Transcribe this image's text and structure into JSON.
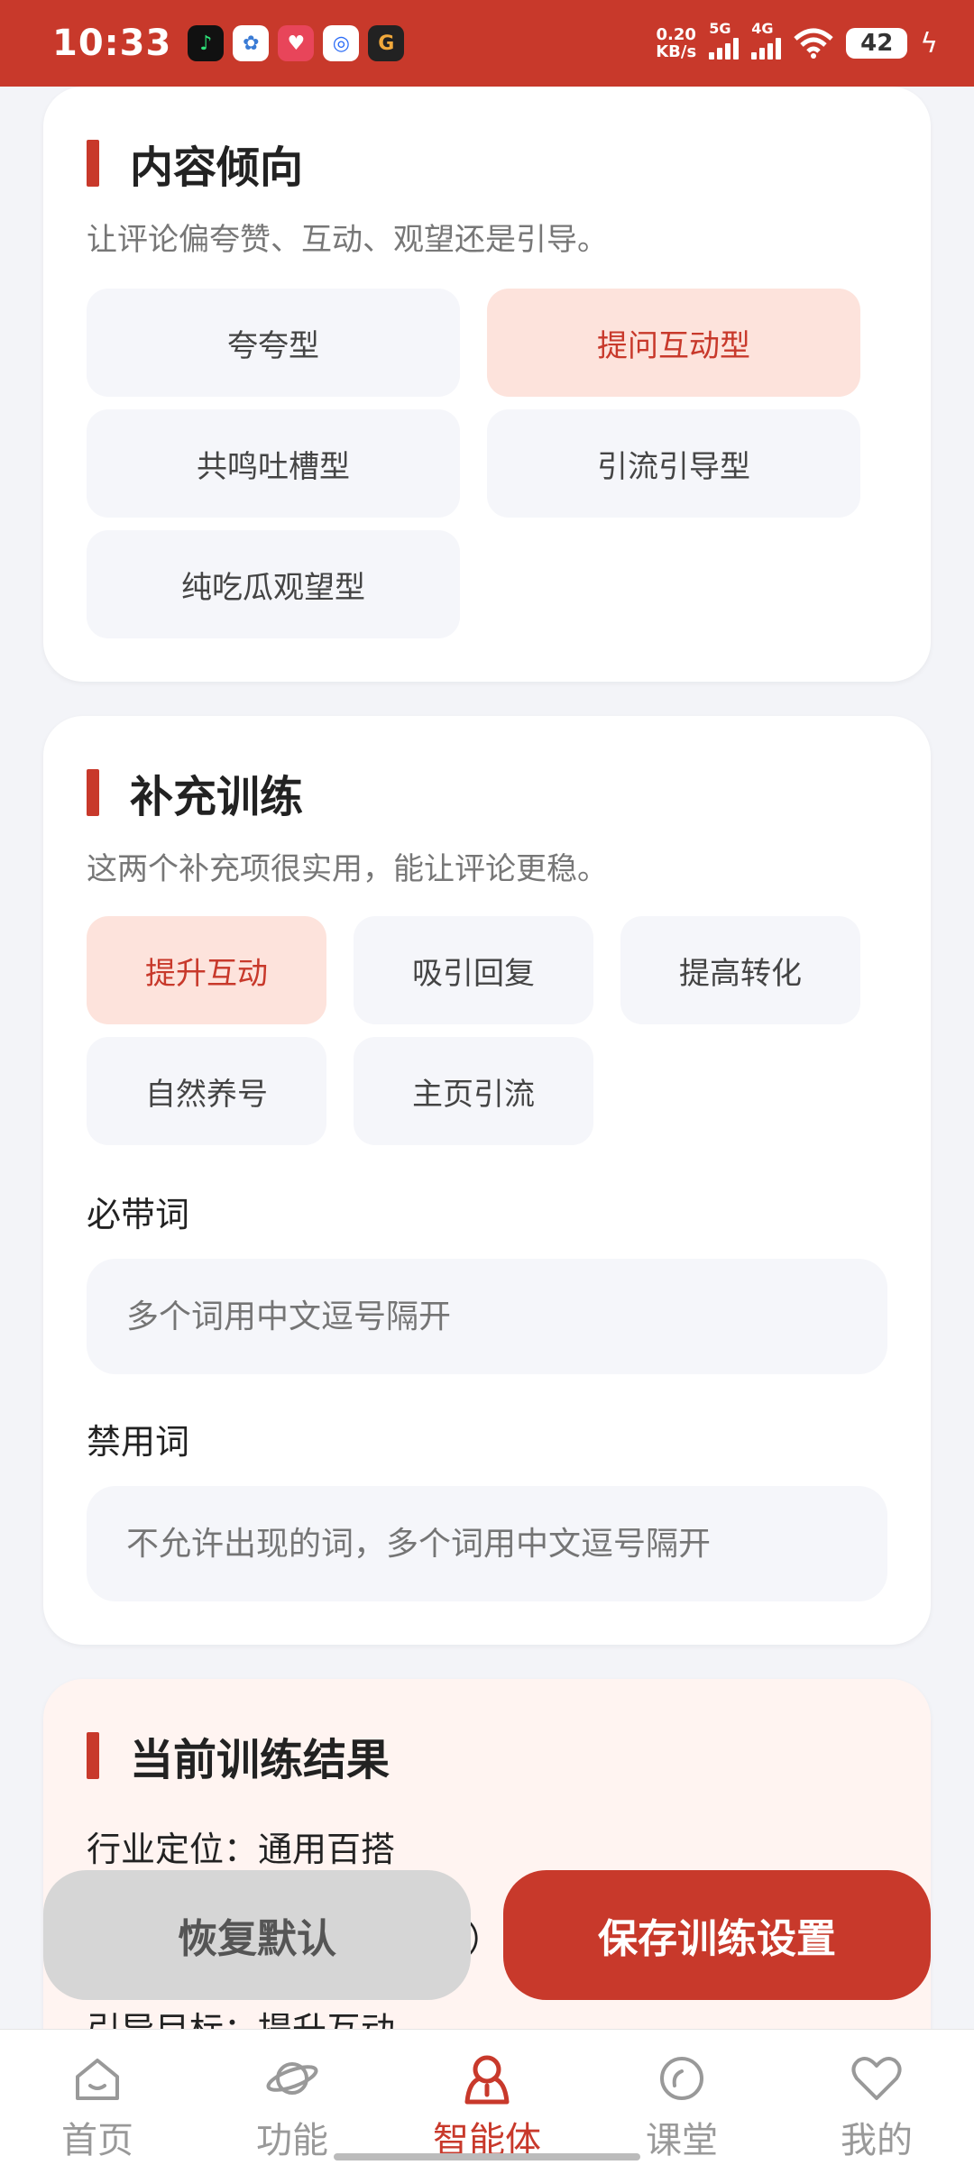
{
  "status_bar": {
    "time": "10:33",
    "net_speed_value": "0.20",
    "net_speed_unit": "KB/s",
    "net1": "5G",
    "net2": "4G",
    "battery": "42",
    "app_icons": [
      "music-app-icon",
      "cloud-app-icon",
      "gift-app-icon",
      "browser-app-icon",
      "game-app-icon"
    ]
  },
  "content_tendency": {
    "title": "内容倾向",
    "desc": "让评论偏夸赞、互动、观望还是引导。",
    "options": [
      "夸夸型",
      "提问互动型",
      "共鸣吐槽型",
      "引流引导型",
      "纯吃瓜观望型"
    ],
    "selected": "提问互动型"
  },
  "supplement_training": {
    "title": "补充训练",
    "desc": "这两个补充项很实用，能让评论更稳。",
    "options": [
      "提升互动",
      "吸引回复",
      "提高转化",
      "自然养号",
      "主页引流"
    ],
    "selected": "提升互动",
    "required_words_label": "必带词",
    "required_words_placeholder": "多个词用中文逗号隔开",
    "banned_words_label": "禁用词",
    "banned_words_placeholder": "不允许出现的词，多个词用中文逗号隔开"
  },
  "current_result": {
    "title": "当前训练结果",
    "line1": "行业定位：通用百搭",
    "line2_partial": "）字",
    "line3": "引导目标：提升互动"
  },
  "actions": {
    "reset_label": "恢复默认",
    "save_label": "保存训练设置"
  },
  "tabbar": {
    "items": [
      "首页",
      "功能",
      "智能体",
      "课堂",
      "我的"
    ],
    "active": "智能体"
  },
  "colors": {
    "brand": "#c8392b",
    "chip_bg": "#f5f6fa",
    "chip_active_bg": "#fde3dc",
    "page_bg": "#f3f4f8"
  }
}
